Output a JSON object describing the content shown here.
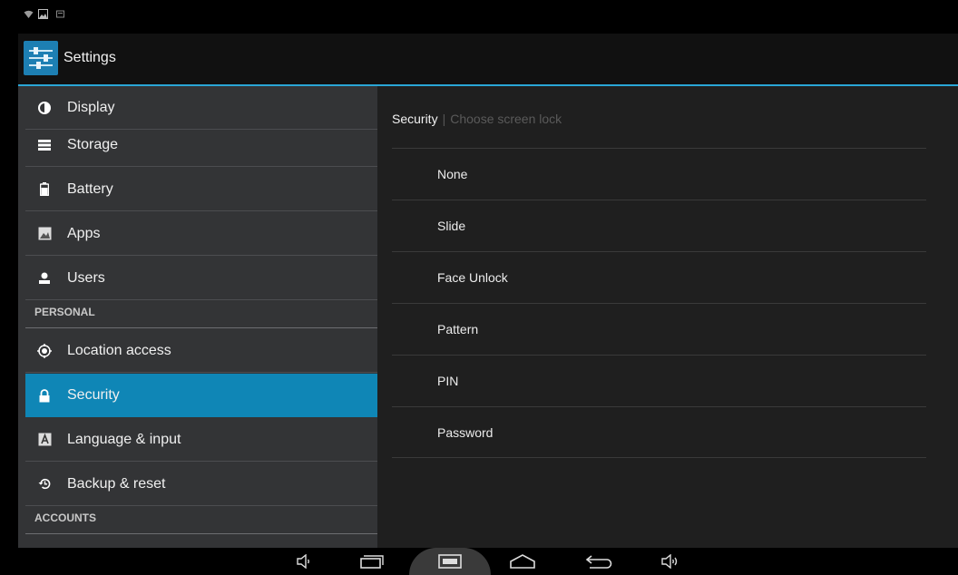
{
  "status_bar": {
    "icons": [
      "wifi-icon",
      "image-icon",
      "notification-icon"
    ]
  },
  "action_bar": {
    "title": "Settings",
    "app_icon": "settings-icon"
  },
  "sidebar": {
    "items": [
      {
        "label": "Display",
        "icon": "display-icon"
      },
      {
        "label": "Storage",
        "icon": "storage-icon"
      },
      {
        "label": "Battery",
        "icon": "battery-icon"
      },
      {
        "label": "Apps",
        "icon": "apps-icon"
      },
      {
        "label": "Users",
        "icon": "users-icon"
      }
    ],
    "personal_header": "PERSONAL",
    "personal_items": [
      {
        "label": "Location access",
        "icon": "location-icon"
      },
      {
        "label": "Security",
        "icon": "lock-icon",
        "selected": true
      },
      {
        "label": "Language & input",
        "icon": "language-icon"
      },
      {
        "label": "Backup & reset",
        "icon": "backup-icon"
      }
    ],
    "accounts_header": "ACCOUNTS"
  },
  "detail": {
    "breadcrumb_current": "Security",
    "breadcrumb_sub": "Choose screen lock",
    "options": [
      "None",
      "Slide",
      "Face Unlock",
      "Pattern",
      "PIN",
      "Password"
    ]
  },
  "nav_bar": {
    "buttons": [
      "volume-down-icon",
      "recents-icon",
      "screenshot-icon",
      "home-icon",
      "back-icon",
      "volume-up-icon"
    ]
  },
  "colors": {
    "accent": "#0f86b6",
    "actionbar_line": "#2aa6d6"
  }
}
